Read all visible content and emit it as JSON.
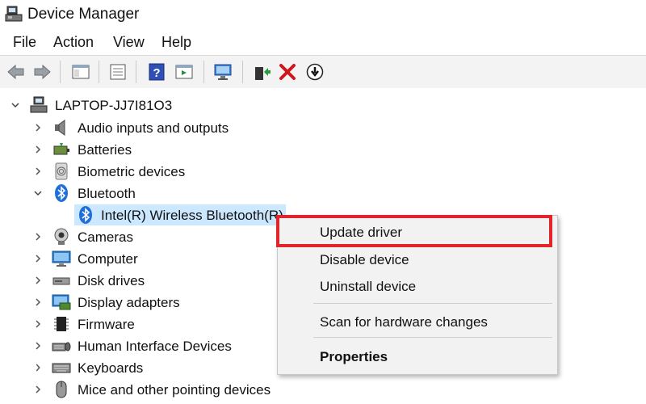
{
  "window": {
    "title": "Device Manager"
  },
  "menu": [
    "File",
    "Action",
    "View",
    "Help"
  ],
  "toolbar": {
    "icons": [
      "back-arrow-icon",
      "forward-arrow-icon",
      "show-hide-console-tree-icon",
      "properties-icon",
      "help-icon",
      "action-pane-icon",
      "scan-hardware-icon",
      "update-driver-icon",
      "uninstall-icon",
      "disable-icon"
    ]
  },
  "tree": {
    "root": "LAPTOP-JJ7I81O3",
    "items": [
      {
        "label": "Audio inputs and outputs",
        "icon": "speaker-icon"
      },
      {
        "label": "Batteries",
        "icon": "battery-icon"
      },
      {
        "label": "Biometric devices",
        "icon": "fingerprint-icon"
      },
      {
        "label": "Bluetooth",
        "icon": "bluetooth-icon",
        "expanded": true
      },
      {
        "label": "Intel(R) Wireless Bluetooth(R)",
        "icon": "bluetooth-icon",
        "child": true,
        "selected": true
      },
      {
        "label": "Cameras",
        "icon": "camera-icon"
      },
      {
        "label": "Computer",
        "icon": "monitor-icon"
      },
      {
        "label": "Disk drives",
        "icon": "disk-drive-icon"
      },
      {
        "label": "Display adapters",
        "icon": "display-adapter-icon"
      },
      {
        "label": "Firmware",
        "icon": "chip-icon"
      },
      {
        "label": "Human Interface Devices",
        "icon": "hid-icon"
      },
      {
        "label": "Keyboards",
        "icon": "keyboard-icon"
      },
      {
        "label": "Mice and other pointing devices",
        "icon": "mouse-icon"
      }
    ]
  },
  "context_menu": {
    "items": [
      {
        "label": "Update driver",
        "highlighted": true
      },
      {
        "label": "Disable device"
      },
      {
        "label": "Uninstall device"
      },
      {
        "label": "Scan for hardware changes"
      },
      {
        "label": "Properties",
        "bold": true
      }
    ]
  },
  "colors": {
    "highlight_border": "#e3242b",
    "selection": "#cce8ff",
    "bluetooth": "#1e6fd9"
  }
}
